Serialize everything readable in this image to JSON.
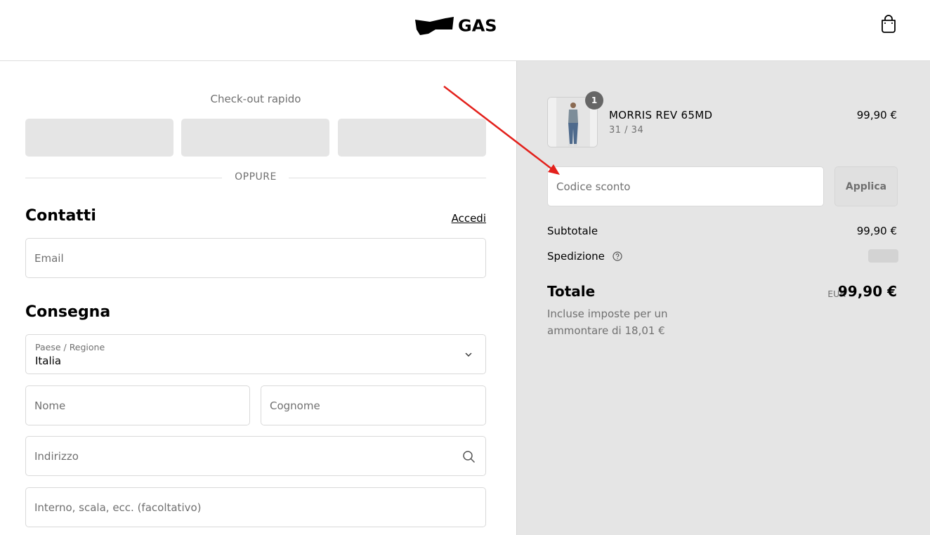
{
  "header": {
    "logo_text": "GAS",
    "cart_icon": "shopping-bag-icon"
  },
  "express": {
    "title": "Check-out rapido",
    "divider_text": "OPPURE"
  },
  "contacts": {
    "title": "Contatti",
    "login_link": "Accedi",
    "email_placeholder": "Email"
  },
  "delivery": {
    "title": "Consegna",
    "country_label": "Paese / Regione",
    "country_value": "Italia",
    "first_name_placeholder": "Nome",
    "last_name_placeholder": "Cognome",
    "address_placeholder": "Indirizzo",
    "address2_placeholder": "Interno, scala, ecc. (facoltativo)"
  },
  "summary": {
    "product": {
      "quantity": "1",
      "name": "MORRIS REV 65MD",
      "variant": "31 / 34",
      "price": "99,90 €"
    },
    "discount_placeholder": "Codice sconto",
    "apply_label": "Applica",
    "subtotal_label": "Subtotale",
    "subtotal_value": "99,90 €",
    "shipping_label": "Spedizione",
    "total_label": "Totale",
    "total_currency": "EUR",
    "total_value": "99,90 €",
    "tax_note": "Incluse imposte per un ammontare di 18,01 €"
  },
  "colors": {
    "annotation_arrow": "#e3211c",
    "summary_bg": "#e5e5e5",
    "placeholder_text": "#707070"
  }
}
